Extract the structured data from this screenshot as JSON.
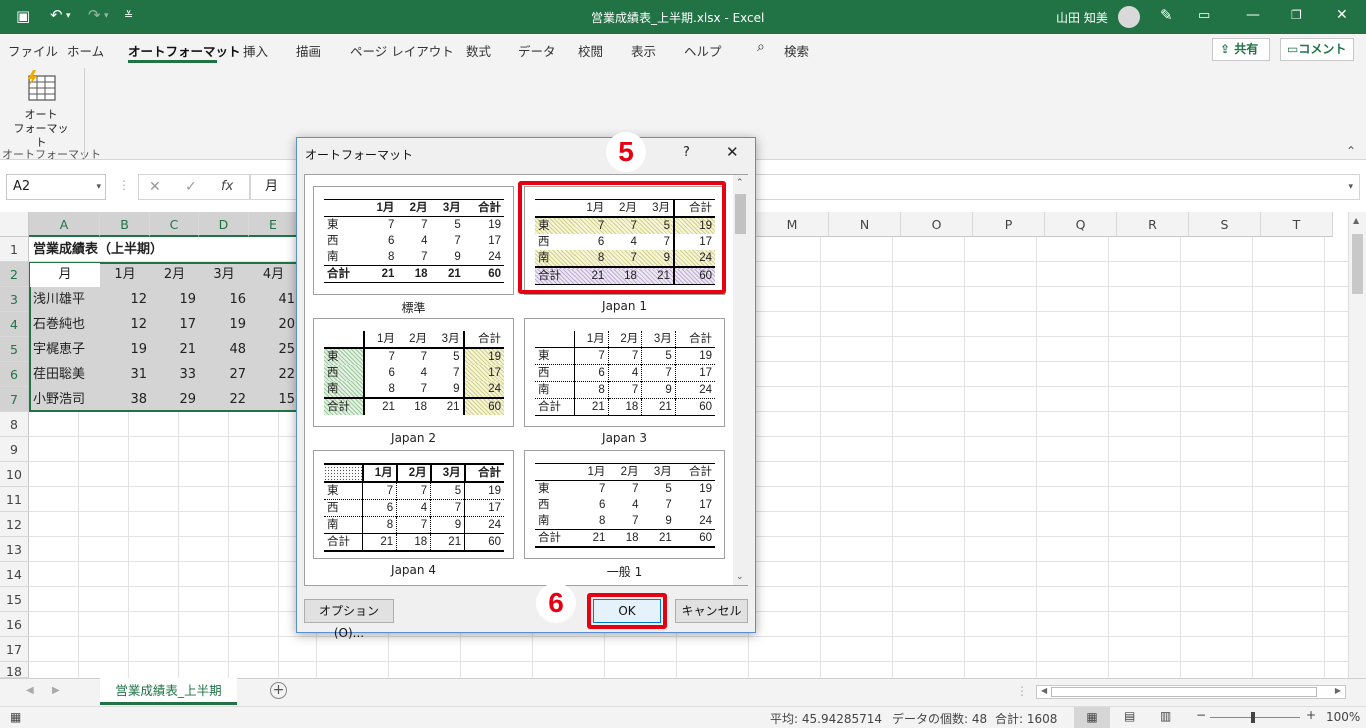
{
  "titlebar": {
    "title": "営業成績表_上半期.xlsx  -  Excel",
    "user": "山田 知美"
  },
  "ribbon_tabs": [
    "ファイル",
    "ホーム",
    "オートフォーマット",
    "挿入",
    "描画",
    "ページ レイアウト",
    "数式",
    "データ",
    "校閲",
    "表示",
    "ヘルプ"
  ],
  "search_label": "検索",
  "share_label": "共有",
  "comment_label": "コメント",
  "ribbon": {
    "autoformat_btn_line1": "オート",
    "autoformat_btn_line2": "フォーマット",
    "group_label": "オートフォーマット"
  },
  "formula_bar": {
    "name_box": "A2",
    "fx": "fx",
    "content": "月"
  },
  "columns": [
    "A",
    "B",
    "C",
    "D",
    "E",
    "M",
    "N",
    "O",
    "P",
    "Q",
    "R",
    "S",
    "T"
  ],
  "rows": [
    "1",
    "2",
    "3",
    "4",
    "5",
    "6",
    "7",
    "8",
    "9",
    "10",
    "11",
    "12",
    "13",
    "14",
    "15",
    "16",
    "17",
    "18"
  ],
  "sheet": {
    "title": "営業成績表（上半期）",
    "header": [
      "月",
      "1月",
      "2月",
      "3月",
      "4月"
    ],
    "data": [
      [
        "浅川雄平",
        "12",
        "19",
        "16",
        "41"
      ],
      [
        "石巻純也",
        "12",
        "17",
        "19",
        "20"
      ],
      [
        "宇梶恵子",
        "19",
        "21",
        "48",
        "25"
      ],
      [
        "荏田聡美",
        "31",
        "33",
        "27",
        "22"
      ],
      [
        "小野浩司",
        "38",
        "29",
        "22",
        "15"
      ]
    ]
  },
  "sheet_tab": "営業成績表_上半期",
  "status": {
    "average": "平均: 45.94285714",
    "count": "データの個数: 48",
    "sum": "合計: 1608",
    "zoom": "100%"
  },
  "dialog": {
    "title": "オートフォーマット",
    "help": "?",
    "close": "✕",
    "formats": [
      "標準",
      "Japan 1",
      "Japan 2",
      "Japan 3",
      "Japan 4",
      "一般 1"
    ],
    "sample_header": [
      "",
      "1月",
      "2月",
      "3月",
      "合計"
    ],
    "sample_rows": [
      [
        "東",
        "7",
        "7",
        "5",
        "19"
      ],
      [
        "西",
        "6",
        "4",
        "7",
        "17"
      ],
      [
        "南",
        "8",
        "7",
        "9",
        "24"
      ],
      [
        "合計",
        "21",
        "18",
        "21",
        "60"
      ]
    ],
    "options_btn": "オプション(O)...",
    "ok_btn": "OK",
    "cancel_btn": "キャンセル"
  },
  "callouts": [
    "5",
    "6"
  ],
  "accent": "#217346",
  "highlight": "#e60012"
}
